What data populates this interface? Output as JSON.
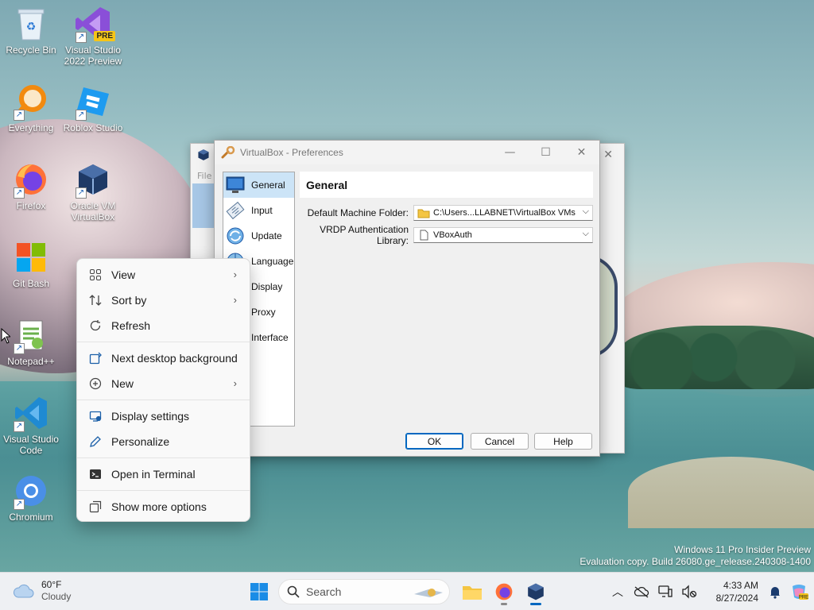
{
  "desktop": {
    "icons": [
      {
        "label": "Recycle Bin"
      },
      {
        "label": "Visual Studio 2022 Preview",
        "badge": "PRE"
      },
      {
        "label": "Everything"
      },
      {
        "label": "Roblox Studio"
      },
      {
        "label": "Firefox"
      },
      {
        "label": "Oracle VM VirtualBox"
      },
      {
        "label": "Git Bash"
      },
      {
        "label": "Notepad++"
      },
      {
        "label": "Visual Studio Code"
      },
      {
        "label": "Chromium"
      }
    ]
  },
  "background_window": {
    "menu_file": "File"
  },
  "dialog": {
    "title": "VirtualBox - Preferences",
    "categories": [
      {
        "label": "General",
        "icon": "monitor-icon"
      },
      {
        "label": "Input",
        "icon": "keyboard-icon"
      },
      {
        "label": "Update",
        "icon": "globe-refresh-icon"
      },
      {
        "label": "Language",
        "icon": "globe-icon"
      },
      {
        "label": "Display",
        "icon": "display-icon"
      },
      {
        "label": "Proxy",
        "icon": "network-icon"
      },
      {
        "label": "Interface",
        "icon": "interface-icon"
      }
    ],
    "selected_category": "General",
    "pane_title": "General",
    "fields": {
      "machine_folder_label": "Default Machine Folder:",
      "machine_folder_value": "C:\\Users...LLABNET\\VirtualBox VMs",
      "vrdp_label": "VRDP Authentication Library:",
      "vrdp_value": "VBoxAuth"
    },
    "buttons": {
      "ok": "OK",
      "cancel": "Cancel",
      "help": "Help"
    }
  },
  "context_menu": {
    "groups": [
      [
        {
          "label": "View",
          "icon": "grid-icon",
          "submenu": true
        },
        {
          "label": "Sort by",
          "icon": "sort-icon",
          "submenu": true
        },
        {
          "label": "Refresh",
          "icon": "refresh-icon",
          "submenu": false
        }
      ],
      [
        {
          "label": "Next desktop background",
          "icon": "next-background-icon",
          "submenu": false
        },
        {
          "label": "New",
          "icon": "plus-circle-icon",
          "submenu": true
        }
      ],
      [
        {
          "label": "Display settings",
          "icon": "display-settings-icon",
          "submenu": false
        },
        {
          "label": "Personalize",
          "icon": "pen-icon",
          "submenu": false
        }
      ],
      [
        {
          "label": "Open in Terminal",
          "icon": "terminal-icon",
          "submenu": false
        }
      ],
      [
        {
          "label": "Show more options",
          "icon": "more-options-icon",
          "submenu": false
        }
      ]
    ]
  },
  "watermark": {
    "line1": "Windows 11 Pro Insider Preview",
    "line2": "Evaluation copy. Build 26080.ge_release.240308-1400"
  },
  "taskbar": {
    "weather": {
      "temp": "60°F",
      "condition": "Cloudy"
    },
    "search_label": "Search",
    "clock": {
      "time": "4:33 AM",
      "date": "8/27/2024"
    }
  },
  "colors": {
    "accent": "#0067c0",
    "selection": "#cce4f7",
    "taskbar": "#eef0f3"
  }
}
